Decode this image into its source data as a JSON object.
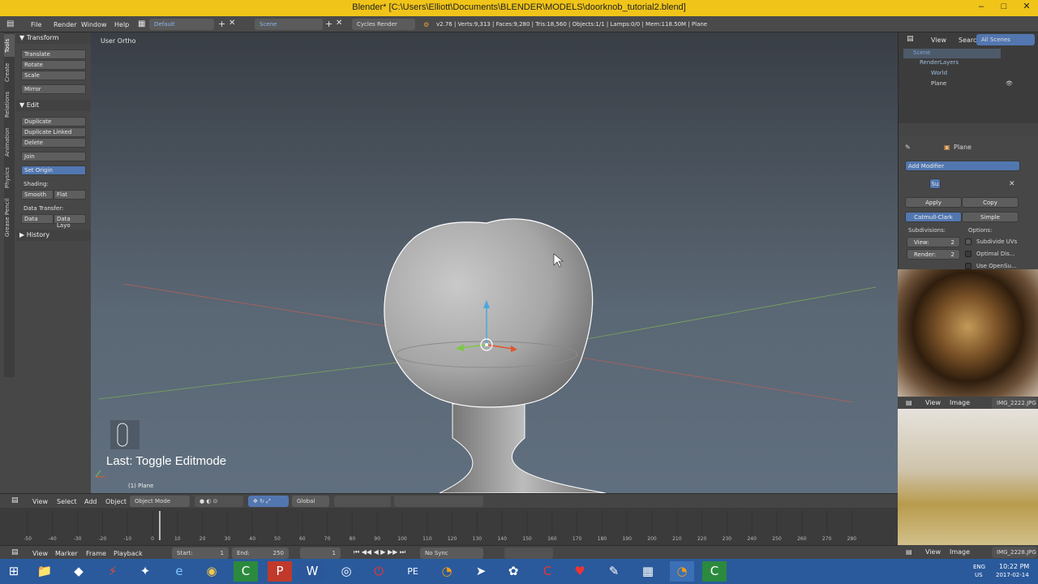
{
  "window": {
    "title": "Blender* [C:\\Users\\Elliott\\Documents\\BLENDER\\MODELS\\doorknob_tutorial2.blend]",
    "min": "–",
    "max": "□",
    "close": "✕"
  },
  "menu": {
    "file": "File",
    "render": "Render",
    "window": "Window",
    "help": "Help",
    "layout": "Default",
    "scene": "Scene",
    "engine": "Cycles Render",
    "stats": "v2.76 | Verts:9,313 | Faces:9,280 | Tris:18,560 | Objects:1/1 | Lamps:0/0 | Mem:118.50M | Plane"
  },
  "toolshelf": {
    "tabs": [
      "Tools",
      "Create",
      "Relations",
      "Animation",
      "Physics",
      "Grease Pencil"
    ],
    "transform": "Transform",
    "translate": "Translate",
    "rotate": "Rotate",
    "scale": "Scale",
    "mirror": "Mirror",
    "edit": "Edit",
    "duplicate": "Duplicate",
    "duplicate_linked": "Duplicate Linked",
    "delete": "Delete",
    "join": "Join",
    "set_origin": "Set Origin",
    "shading": "Shading:",
    "smooth": "Smooth",
    "flat": "Flat",
    "data_transfer": "Data Transfer:",
    "data": "Data",
    "data_layo": "Data Layo",
    "history": "History"
  },
  "viewport": {
    "view_label": "User Ortho",
    "last_op": "Last: Toggle Editmode",
    "obj_label": "(1) Plane"
  },
  "vpheader": {
    "view": "View",
    "select": "Select",
    "add": "Add",
    "object": "Object",
    "mode": "Object Mode",
    "orientation": "Global"
  },
  "timeline": {
    "ticks": [
      "-50",
      "-40",
      "-30",
      "-20",
      "-10",
      "0",
      "10",
      "20",
      "30",
      "40",
      "50",
      "60",
      "70",
      "80",
      "90",
      "100",
      "110",
      "120",
      "130",
      "140",
      "150",
      "160",
      "170",
      "180",
      "190",
      "200",
      "210",
      "220",
      "230",
      "240",
      "250",
      "260",
      "270",
      "280"
    ]
  },
  "tlbar": {
    "view": "View",
    "marker": "Marker",
    "frame": "Frame",
    "playback": "Playback",
    "start_label": "Start:",
    "start": "1",
    "end_label": "End:",
    "end": "250",
    "current": "1",
    "sync": "No Sync"
  },
  "outliner": {
    "view": "View",
    "search": "Search",
    "all_scenes": "All Scenes",
    "scene": "Scene",
    "renderlayers": "RenderLayers",
    "world": "World",
    "plane": "Plane"
  },
  "props": {
    "object": "Plane",
    "add_modifier": "Add Modifier",
    "mod_name": "Su",
    "apply": "Apply",
    "copy": "Copy",
    "catmull": "Catmull-Clark",
    "simple": "Simple",
    "subdivisions": "Subdivisions:",
    "options": "Options:",
    "view_label": "View:",
    "view_val": "2",
    "render_label": "Render:",
    "render_val": "2",
    "subdivide_uvs": "Subdivide UVs",
    "optimal": "Optimal Dis...",
    "use_opensubdiv": "Use OpenSu..."
  },
  "imgbar1": {
    "view": "View",
    "image": "Image",
    "file": "IMG_2222.JPG"
  },
  "imgbar2": {
    "view": "View",
    "image": "Image",
    "file": "IMG_2228.JPG"
  },
  "taskbar": {
    "lang": "ENG",
    "region": "US",
    "time": "10:22 PM",
    "date": "2017-02-14"
  }
}
